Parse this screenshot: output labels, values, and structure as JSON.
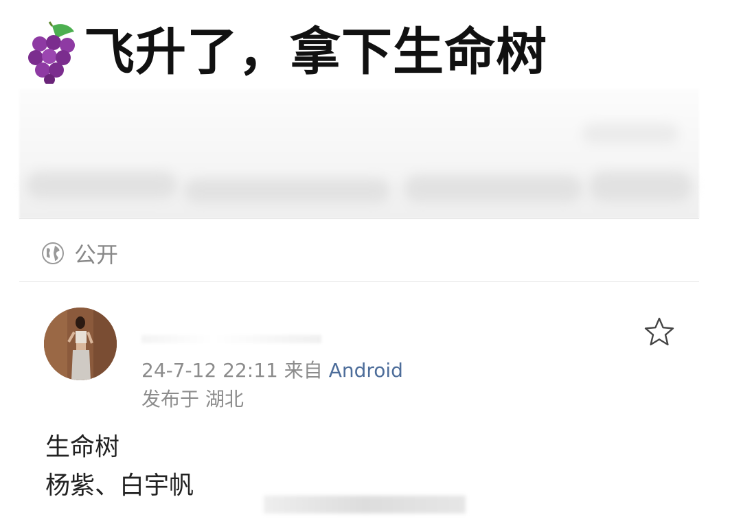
{
  "post": {
    "headline": "飞升了，拿下生命树",
    "visibility_label": "公开",
    "meta": {
      "timestamp": "24-7-12 22:11",
      "source_prefix": "来自",
      "source": "Android",
      "location": "发布于 湖北"
    },
    "body_lines": [
      "生命树",
      "杨紫、白宇帆"
    ]
  },
  "icons": {
    "headline_emoji": "grape-icon",
    "visibility": "globe-icon",
    "favorite": "star-icon"
  },
  "colors": {
    "headline_text": "#111111",
    "meta_text": "#8c8c8c",
    "source_link": "#4d6d9a",
    "divider": "#e6e6e6",
    "grape": "#7b2d8e",
    "leaf": "#4caf50"
  }
}
